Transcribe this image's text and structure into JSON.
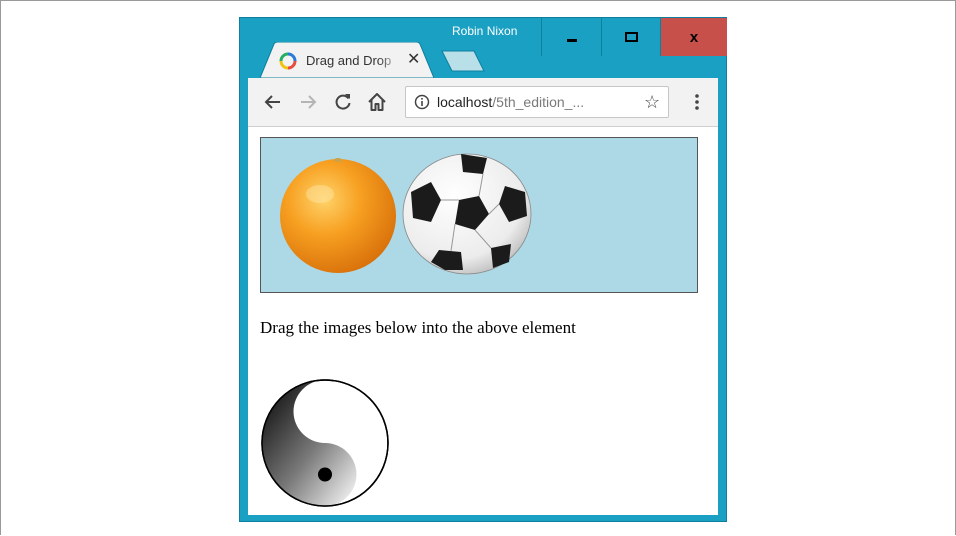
{
  "window": {
    "user_name": "Robin Nixon",
    "close_glyph": "x",
    "tab_title": "Drag and Drop",
    "tab_close_glyph": "✕",
    "close_color": "#c7504a",
    "frame_color": "#1aa0c2"
  },
  "toolbar": {
    "url_host": "localhost",
    "url_path": "/5th_edition_...",
    "star_glyph": "☆"
  },
  "page": {
    "drop_zone_color": "#add8e6",
    "instruction": "Drag the images below into the above element",
    "drop_zone_images": [
      "orange-image",
      "soccer-ball-image"
    ],
    "source_images": [
      "yin-yang-image"
    ]
  }
}
